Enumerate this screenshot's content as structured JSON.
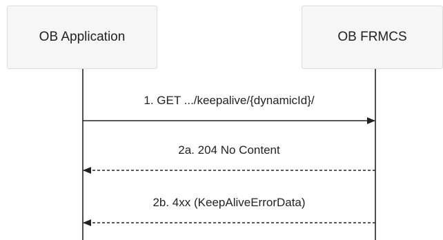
{
  "participants": {
    "left": "OB Application",
    "right": "OB FRMCS"
  },
  "messages": [
    {
      "label": "1. GET .../keepalive/{dynamicId}/",
      "direction": "right",
      "style": "solid"
    },
    {
      "label": "2a. 204 No Content",
      "direction": "left",
      "style": "dashed"
    },
    {
      "label": "2b. 4xx (KeepAliveErrorData)",
      "direction": "left",
      "style": "dashed"
    }
  ],
  "colors": {
    "line": "#222222",
    "box_fill": "#f6f6f6",
    "box_border": "#dcdcdc"
  }
}
